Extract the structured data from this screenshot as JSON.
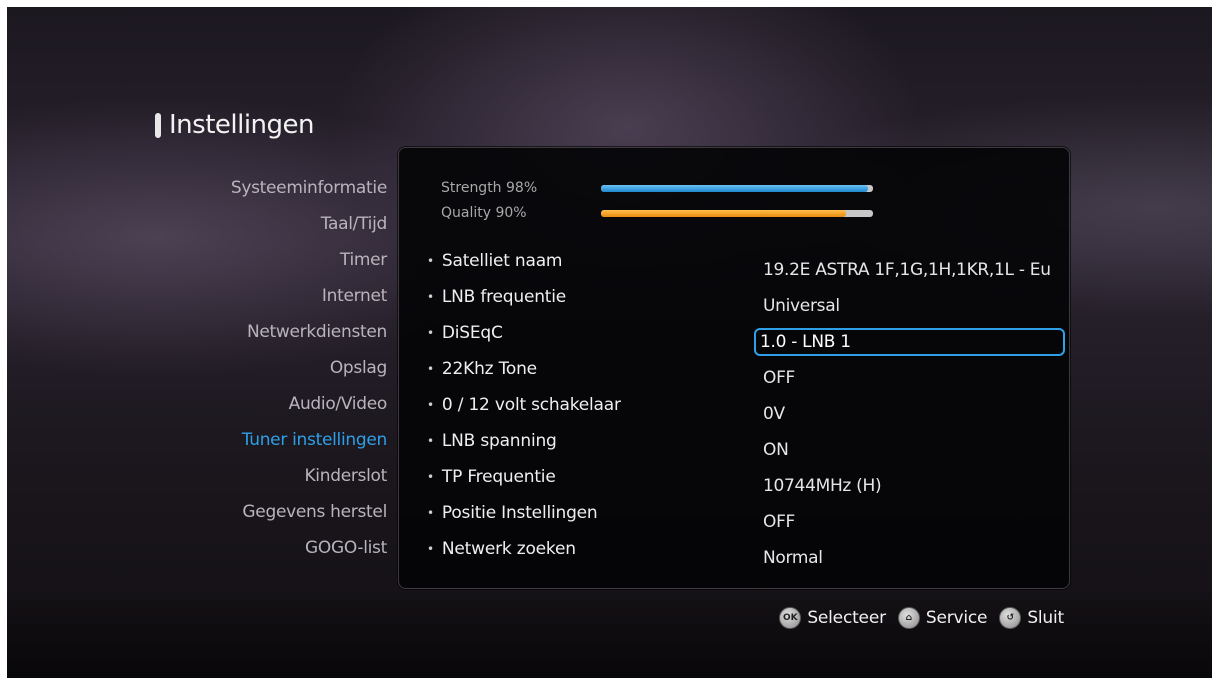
{
  "screen": {
    "title": "Instellingen"
  },
  "menu": {
    "items": [
      {
        "label": "Systeeminformatie"
      },
      {
        "label": "Taal/Tijd"
      },
      {
        "label": "Timer"
      },
      {
        "label": "Internet"
      },
      {
        "label": "Netwerkdiensten"
      },
      {
        "label": "Opslag"
      },
      {
        "label": "Audio/Video"
      },
      {
        "label": "Tuner instellingen",
        "active": true
      },
      {
        "label": "Kinderslot"
      },
      {
        "label": "Gegevens herstel"
      },
      {
        "label": "GOGO-list"
      }
    ]
  },
  "signal": {
    "strength": {
      "label": "Strength 98%",
      "percent": 98
    },
    "quality": {
      "label": "Quality 90%",
      "percent": 90
    }
  },
  "settings": [
    {
      "label": "Satelliet naam",
      "value": "19.2E ASTRA 1F,1G,1H,1KR,1L - Eu"
    },
    {
      "label": "LNB frequentie",
      "value": "Universal"
    },
    {
      "label": "DiSEqC",
      "value": "1.0 - LNB 1",
      "focused": true
    },
    {
      "label": "22Khz Tone",
      "value": "OFF"
    },
    {
      "label": "0 / 12 volt schakelaar",
      "value": "0V"
    },
    {
      "label": "LNB spanning",
      "value": "ON"
    },
    {
      "label": "TP Frequentie",
      "value": "10744MHz (H)"
    },
    {
      "label": "Positie Instellingen",
      "value": "OFF"
    },
    {
      "label": "Netwerk zoeken",
      "value": "Normal"
    }
  ],
  "hints": [
    {
      "icon": "ok-button-icon",
      "glyph": "OK",
      "label": "Selecteer"
    },
    {
      "icon": "home-button-icon",
      "glyph": "⌂",
      "label": "Service"
    },
    {
      "icon": "back-button-icon",
      "glyph": "↺",
      "label": "Sluit"
    }
  ],
  "colors": {
    "accent": "#2f9fe8",
    "strength_bar": "#1e86cf",
    "quality_bar": "#e88a10"
  }
}
